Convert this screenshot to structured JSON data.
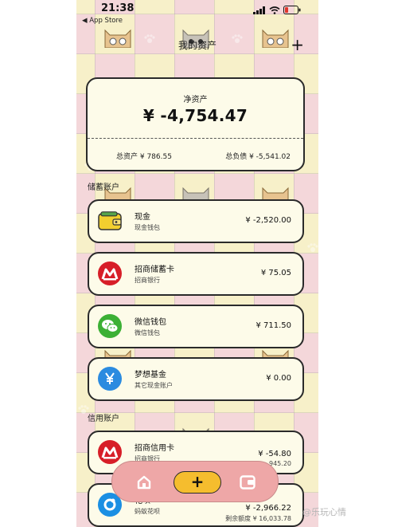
{
  "status_bar": {
    "time": "21:38",
    "back_app": "◀ App Store"
  },
  "header": {
    "title": "我的资产",
    "add_label": "+"
  },
  "net_worth": {
    "label": "净资产",
    "value": "¥ -4,754.47",
    "total_assets": "总资产 ¥ 786.55",
    "total_liabilities": "总负债 ¥ -5,541.02"
  },
  "sections": {
    "savings": "储蓄账户",
    "credit": "信用账户"
  },
  "savings_accounts": [
    {
      "name": "现金",
      "type": "现金钱包",
      "amount": "¥ -2,520.00",
      "icon": "wallet-icon",
      "color": "#f2cf2f"
    },
    {
      "name": "招商储蓄卡",
      "type": "招商银行",
      "amount": "¥ 75.05",
      "icon": "cmb-logo-icon",
      "color": "#d71e28"
    },
    {
      "name": "微信钱包",
      "type": "微信钱包",
      "amount": "¥ 711.50",
      "icon": "wechat-icon",
      "color": "#3cb035"
    },
    {
      "name": "梦想基金",
      "type": "其它现金账户",
      "amount": "¥ 0.00",
      "icon": "yen-icon",
      "color": "#2b8be0"
    }
  ],
  "credit_accounts": [
    {
      "name": "招商信用卡",
      "type": "招商银行",
      "amount": "¥ -54.80",
      "extra": "945.20",
      "icon": "cmb-logo-icon",
      "color": "#d71e28"
    },
    {
      "name": "花呗",
      "type": "蚂蚁花呗",
      "amount": "¥ -2,966.22",
      "extra": "剩余额度 ¥ 16,033.78",
      "icon": "huabei-icon",
      "color": "#1b8fe3"
    }
  ],
  "tab_bar": {
    "add_label": "+"
  },
  "watermark": "@乐玩心情"
}
